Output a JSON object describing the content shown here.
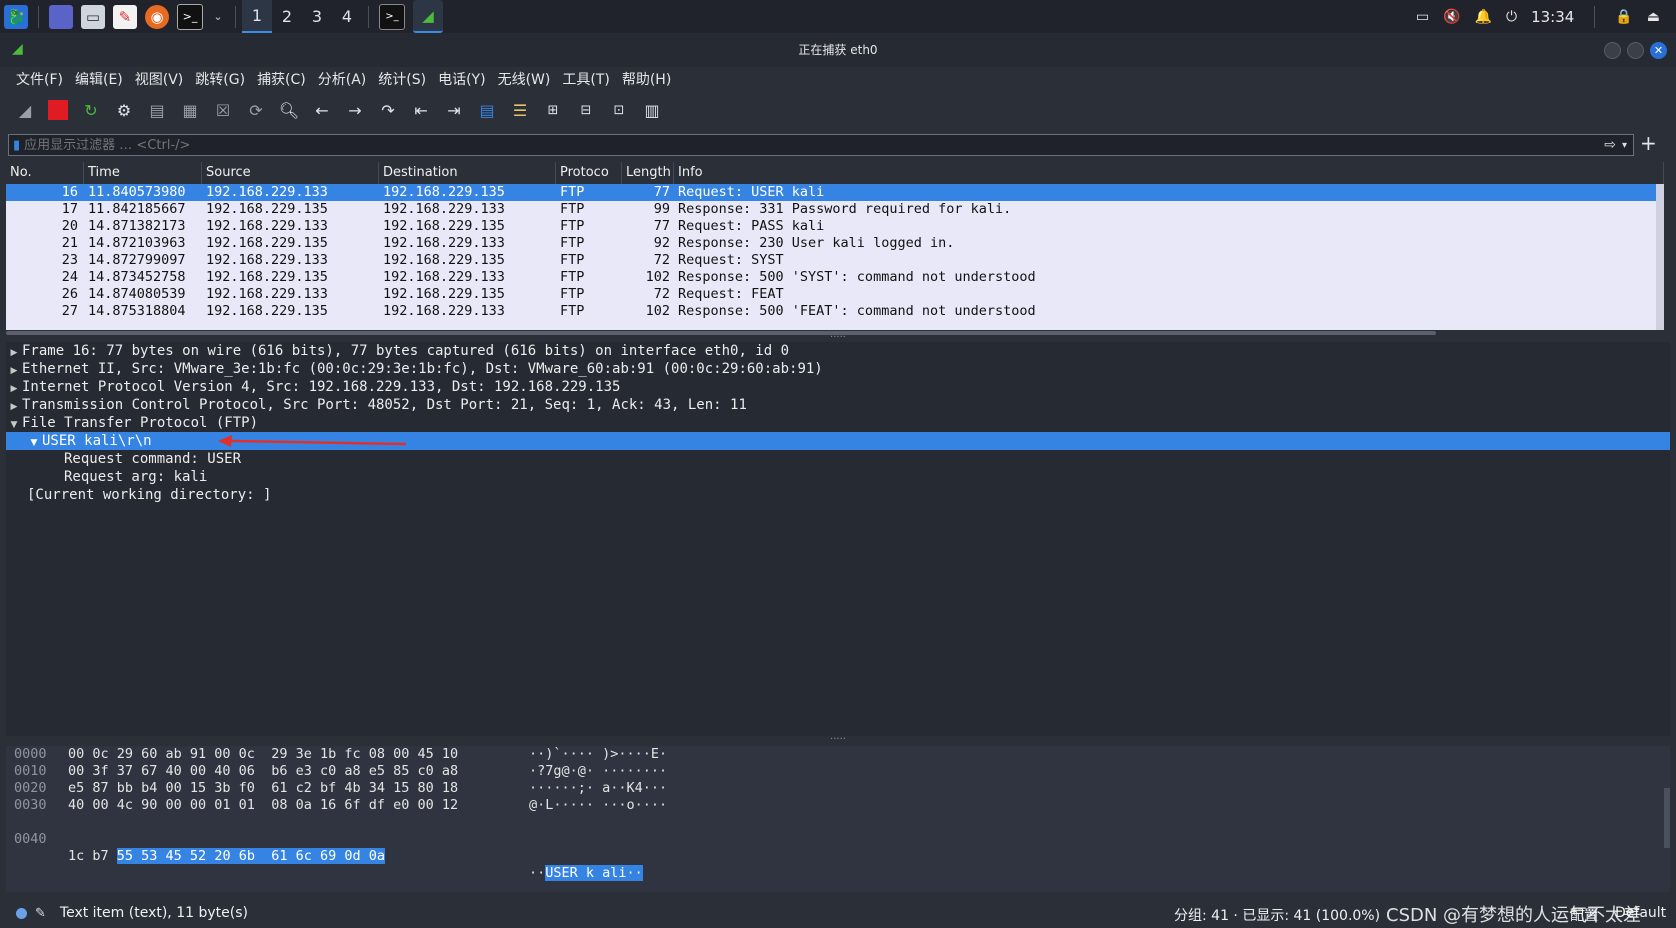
{
  "taskbar": {
    "workspaces": [
      "1",
      "2",
      "3",
      "4"
    ],
    "active_workspace": "1",
    "clock": "13:34"
  },
  "window": {
    "title": "正在捕获 eth0"
  },
  "menu": [
    "文件(F)",
    "编辑(E)",
    "视图(V)",
    "跳转(G)",
    "捕获(C)",
    "分析(A)",
    "统计(S)",
    "电话(Y)",
    "无线(W)",
    "工具(T)",
    "帮助(H)"
  ],
  "filter": {
    "placeholder": "应用显示过滤器 … <Ctrl-/>"
  },
  "packet_list": {
    "headers": {
      "no": "No.",
      "time": "Time",
      "source": "Source",
      "destination": "Destination",
      "protocol": "Protoco",
      "length": "Length",
      "info": "Info"
    },
    "rows": [
      {
        "no": "16",
        "time": "11.840573980",
        "src": "192.168.229.133",
        "dst": "192.168.229.135",
        "proto": "FTP",
        "len": "77",
        "info": "Request: USER kali"
      },
      {
        "no": "17",
        "time": "11.842185667",
        "src": "192.168.229.135",
        "dst": "192.168.229.133",
        "proto": "FTP",
        "len": "99",
        "info": "Response: 331 Password required for kali."
      },
      {
        "no": "20",
        "time": "14.871382173",
        "src": "192.168.229.133",
        "dst": "192.168.229.135",
        "proto": "FTP",
        "len": "77",
        "info": "Request: PASS kali"
      },
      {
        "no": "21",
        "time": "14.872103963",
        "src": "192.168.229.135",
        "dst": "192.168.229.133",
        "proto": "FTP",
        "len": "92",
        "info": "Response: 230 User kali logged in."
      },
      {
        "no": "23",
        "time": "14.872799097",
        "src": "192.168.229.133",
        "dst": "192.168.229.135",
        "proto": "FTP",
        "len": "72",
        "info": "Request: SYST"
      },
      {
        "no": "24",
        "time": "14.873452758",
        "src": "192.168.229.135",
        "dst": "192.168.229.133",
        "proto": "FTP",
        "len": "102",
        "info": "Response: 500 'SYST': command not understood"
      },
      {
        "no": "26",
        "time": "14.874080539",
        "src": "192.168.229.133",
        "dst": "192.168.229.135",
        "proto": "FTP",
        "len": "72",
        "info": "Request: FEAT"
      },
      {
        "no": "27",
        "time": "14.875318804",
        "src": "192.168.229.135",
        "dst": "192.168.229.133",
        "proto": "FTP",
        "len": "102",
        "info": "Response: 500 'FEAT': command not understood"
      }
    ]
  },
  "detail": {
    "frame": "Frame 16: 77 bytes on wire (616 bits), 77 bytes captured (616 bits) on interface eth0, id 0",
    "ethernet": "Ethernet II, Src: VMware_3e:1b:fc (00:0c:29:3e:1b:fc), Dst: VMware_60:ab:91 (00:0c:29:60:ab:91)",
    "ip": "Internet Protocol Version 4, Src: 192.168.229.133, Dst: 192.168.229.135",
    "tcp": "Transmission Control Protocol, Src Port: 48052, Dst Port: 21, Seq: 1, Ack: 43, Len: 11",
    "ftp": "File Transfer Protocol (FTP)",
    "user": "USER kali\\r\\n",
    "req_cmd": "Request command: USER",
    "req_arg": "Request arg: kali",
    "cwd": "[Current working directory: ]"
  },
  "bytes": {
    "rows": [
      {
        "off": "0000",
        "hex": "00 0c 29 60 ab 91 00 0c  29 3e 1b fc 08 00 45 10",
        "asc": "··)`···· )>····E·"
      },
      {
        "off": "0010",
        "hex": "00 3f 37 67 40 00 40 06  b6 e3 c0 a8 e5 85 c0 a8",
        "asc": "·?7g@·@· ········"
      },
      {
        "off": "0020",
        "hex": "e5 87 bb b4 00 15 3b f0  61 c2 bf 4b 34 15 80 18",
        "asc": "······;· a··K4···"
      },
      {
        "off": "0030",
        "hex": "40 00 4c 90 00 00 01 01  08 0a 16 6f df e0 00 12",
        "asc": "@·L····· ···o····"
      }
    ],
    "last": {
      "off": "0040",
      "hex_pre": "1c b7 ",
      "hex_hl": "55 53 45 52 20 6b  61 6c 69 0d 0a",
      "asc_pre": "··",
      "asc_hl": "USER k ali··"
    }
  },
  "status": {
    "text": "Text item (text), 11 byte(s)",
    "stats": "分组: 41 · 已显示: 41 (100.0%)",
    "profile_label": "配置",
    "profile": "Default",
    "watermark": "CSDN @有梦想的人运气不太差"
  },
  "colors": {
    "selection": "#3584e4",
    "packet_bg": "#e8e8f8",
    "annotation_arrow": "#e0302c"
  }
}
